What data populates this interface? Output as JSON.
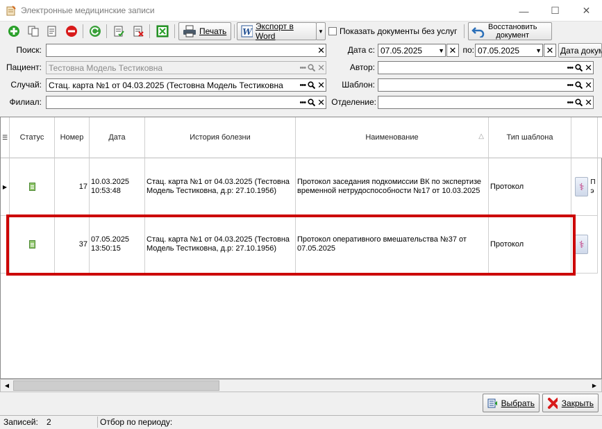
{
  "window": {
    "title": "Электронные медицинские записи",
    "controls": {
      "minimize": "—",
      "maximize": "☐",
      "close": "✕"
    }
  },
  "toolbar": {
    "print_label": "Печать",
    "export_word_label": "Экспорт в Word",
    "show_without_services_label": "Показать документы без услуг",
    "restore_label_line1": "Восстановить",
    "restore_label_line2": "документ"
  },
  "filters": {
    "search_label": "Поиск:",
    "search_value": "",
    "patient_label": "Пациент:",
    "patient_value": "Тестовна Модель Тестиковна",
    "case_label": "Случай:",
    "case_value": "Стац. карта №1 от 04.03.2025 (Тестовна Модель Тестиковна",
    "branch_label": "Филиал:",
    "branch_value": "",
    "date_from_label": "Дата с:",
    "date_from_value": "07.05.2025",
    "date_to_label": "по:",
    "date_to_value": "07.05.2025",
    "date_type_value": "Дата докум",
    "author_label": "Автор:",
    "author_value": "",
    "template_label": "Шаблон:",
    "template_value": "",
    "department_label": "Отделение:",
    "department_value": ""
  },
  "grid": {
    "columns": [
      "Статус",
      "Номер",
      "Дата",
      "История болезни",
      "Наименование",
      "Тип шаблона"
    ],
    "sort_indicator": "△",
    "rows": [
      {
        "number": "17",
        "date": "10.03.2025",
        "time": "10:53:48",
        "history": "Стац. карта №1 от 04.03.2025 (Тестовна Модель Тестиковна, д.р: 27.10.1956)",
        "name": "Протокол заседания подкомиссии ВК по экспертизе временной нетрудоспособности №17 от 10.03.2025",
        "template_type": "Протокол",
        "extra": "П э"
      },
      {
        "number": "37",
        "date": "07.05.2025",
        "time": "13:50:15",
        "history": "Стац. карта №1 от 04.03.2025 (Тестовна Модель Тестиковна, д.р: 27.10.1956)",
        "name": "Протокол оперативного вмешательства №37 от 07.05.2025",
        "template_type": "Протокол",
        "extra": ""
      }
    ]
  },
  "buttons": {
    "select_label": "Выбрать",
    "close_label": "Закрыть"
  },
  "status_bar": {
    "records_label": "Записей:",
    "records_value": "2",
    "period_filter_label": "Отбор по периоду:",
    "period_filter_value": ""
  },
  "colors": {
    "highlight": "#cc0000",
    "add": "#2aa02a",
    "delete": "#d81a1a",
    "refresh": "#3aa03a"
  }
}
